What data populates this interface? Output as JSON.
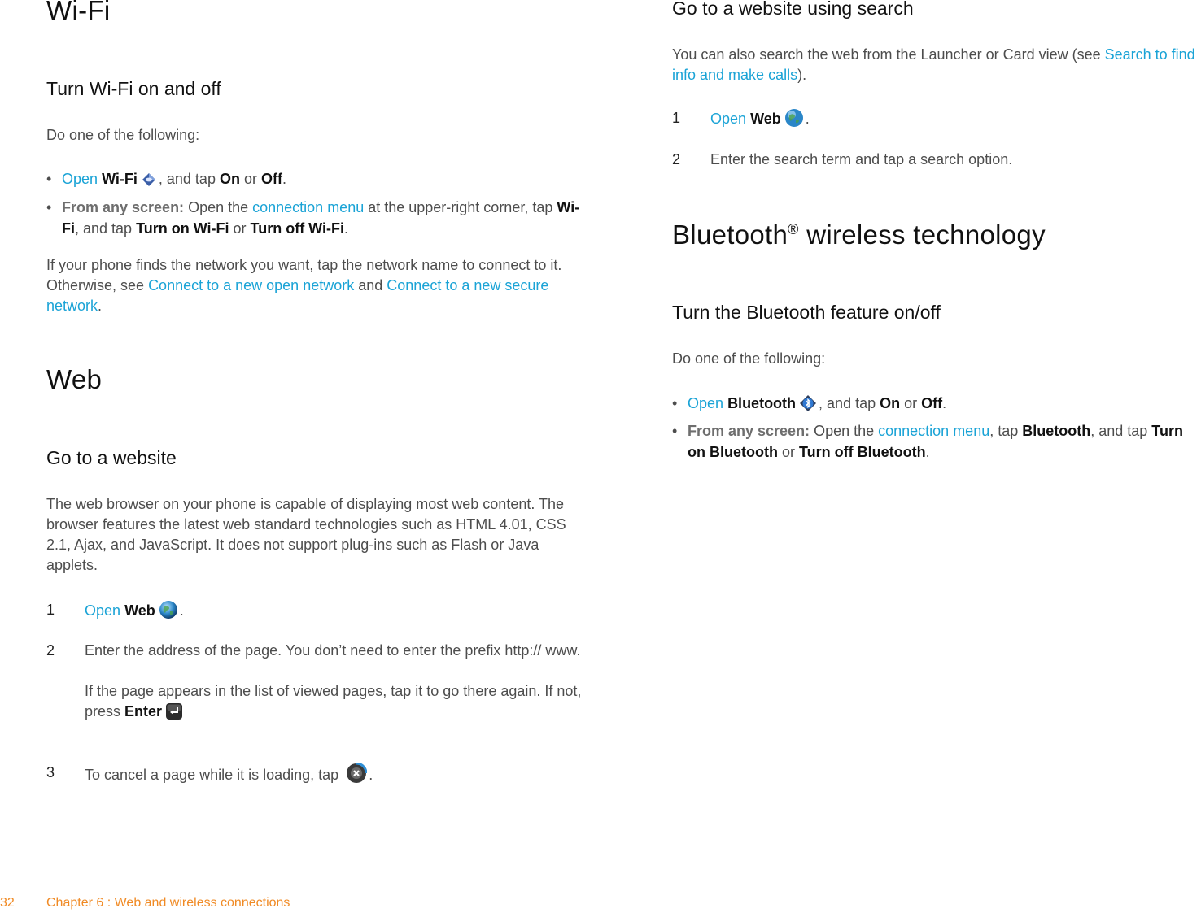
{
  "left": {
    "wifi_title": "Wi-Fi",
    "wifi_sub": "Turn Wi-Fi on and off",
    "wifi_intro": "Do one of the following:",
    "wifi_b1": {
      "open": "Open",
      "app": "Wi-Fi",
      "mid": ", and tap ",
      "on": "On",
      "or": " or ",
      "off": "Off",
      "end": "."
    },
    "wifi_b2": {
      "lead": "From any screen:",
      "t1": " Open the ",
      "link": "connection menu",
      "t2": " at the upper-right corner, tap ",
      "wifi": "Wi-Fi",
      "t3": ", and tap ",
      "on": "Turn on Wi-Fi",
      "or": " or ",
      "off": "Turn off Wi-Fi",
      "end": "."
    },
    "wifi_para": {
      "t1": "If your phone finds the network you want, tap the network name to connect to it. Otherwise, see ",
      "link1": "Connect to a new open network",
      "and": " and ",
      "link2": "Connect to a new secure network",
      "end": "."
    },
    "web_title": "Web",
    "web_sub": "Go to a website",
    "web_para": "The web browser on your phone is capable of displaying most web content. The browser features the latest web standard technologies such as HTML 4.01, CSS 2.1, Ajax, and JavaScript. It does not support plug-ins such as Flash or Java applets.",
    "steps": [
      {
        "num": "1",
        "open": "Open",
        "app": "Web",
        "end": "."
      },
      {
        "num": "2",
        "text": "Enter the address of the page. You don’t need to enter the prefix http:// www.",
        "note": "If the page appears in the list of viewed pages, tap it to go there again. If not, press ",
        "enter": "Enter"
      },
      {
        "num": "3",
        "text": "To cancel a page while it is loading, tap ",
        "end": "."
      }
    ]
  },
  "right": {
    "search_sub": "Go to a website using search",
    "search_para": {
      "t1": "You can also search the web from the Launcher or Card view (see ",
      "link": "Search to find info and make calls",
      "end": ")."
    },
    "steps": [
      {
        "num": "1",
        "open": "Open",
        "app": "Web",
        "end": "."
      },
      {
        "num": "2",
        "text": "Enter the search term and tap a search option."
      }
    ],
    "bt_title": "Bluetooth",
    "bt_reg": "®",
    "bt_title_rest": " wireless technology",
    "bt_sub": "Turn the Bluetooth feature on/off",
    "bt_intro": "Do one of the following:",
    "bt_b1": {
      "open": "Open",
      "app": "Bluetooth",
      "mid": ", and tap ",
      "on": "On",
      "or": " or ",
      "off": "Off",
      "end": "."
    },
    "bt_b2": {
      "lead": "From any screen:",
      "t1": " Open the ",
      "link": "connection menu",
      "t2": ", tap ",
      "bt": "Bluetooth",
      "t3": ", and tap ",
      "on": "Turn on Bluetooth",
      "or": " or ",
      "off": "Turn off Bluetooth",
      "end": "."
    }
  },
  "footer": {
    "page": "32",
    "chapter": "Chapter 6  :  Web and wireless connections"
  },
  "icons": {
    "wifi": "wifi-app-icon",
    "web": "web-globe-icon",
    "enter": "enter-key-icon",
    "cancel": "cancel-load-icon",
    "bluetooth": "bluetooth-app-icon"
  },
  "colors": {
    "link": "#1aa3d6",
    "footer": "#f08a24"
  }
}
